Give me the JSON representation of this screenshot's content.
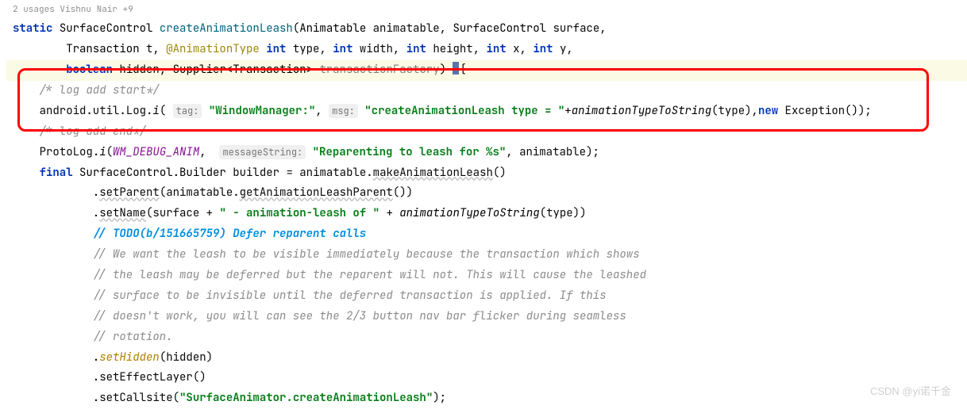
{
  "usage": "2 usages    Vishnu Nair +9",
  "line1": {
    "kw1": "static",
    "type1": "SurfaceControl",
    "method": "createAnimationLeash",
    "p1t": "Animatable",
    "p1n": "animatable",
    "p2t": "SurfaceControl",
    "p2n": "surface"
  },
  "line2": {
    "p3t": "Transaction",
    "p3n": "t",
    "anno": "@AnimationType",
    "kwint": "int",
    "p4n": "type",
    "p5n": "width",
    "p6n": "height",
    "p7n": "x",
    "p8n": "y"
  },
  "line3": {
    "kw": "boolean",
    "p9n": "hidden",
    "p10t": "Supplier<Transaction>",
    "p10n": "transactionFactory",
    "brace": "{"
  },
  "line4": {
    "comment": "/* log add start*/"
  },
  "line5": {
    "prefix": "android.util.Log.",
    "method": "i",
    "hint1": "tag:",
    "str1": "\"WindowManager:\"",
    "hint2": "msg:",
    "str2": "\"createAnimationLeash type = \"",
    "plus": "+",
    "call": "animationTypeToString",
    "arg": "type",
    "kwnew": "new",
    "exc": "Exception"
  },
  "line6": {
    "comment": "/* log add end*/"
  },
  "line7": {
    "cls": "ProtoLog",
    "method": "i",
    "const": "WM_DEBUG_ANIM",
    "hint": "messageString:",
    "str": "\"Reparenting to leash for %s\"",
    "arg": "animatable"
  },
  "line8": {
    "kw": "final",
    "type": "SurfaceControl.Builder",
    "var": "builder",
    "eq": "=",
    "obj": "animatable",
    "method": "makeAnimationLeash"
  },
  "line9": {
    "method": "setParent",
    "obj": "animatable",
    "call": "getAnimationLeashParent"
  },
  "line10": {
    "method": "setName",
    "arg1": "surface",
    "str": "\" - animation-leash of \"",
    "call": "animationTypeToString",
    "arg2": "type"
  },
  "line11": {
    "comment": "// TODO(b/151665759) Defer reparent calls"
  },
  "line12": {
    "comment": "// We want the leash to be visible immediately because the transaction which shows"
  },
  "line13": {
    "comment": "// the leash may be deferred but the reparent will not. This will cause the leashed"
  },
  "line14": {
    "comment": "// surface to be invisible until the deferred transaction is applied. If this"
  },
  "line15": {
    "comment": "// doesn't work, you will can see the 2/3 button nav bar flicker during seamless"
  },
  "line16": {
    "comment": "// rotation."
  },
  "line17": {
    "method": "setHidden",
    "arg": "hidden"
  },
  "line18": {
    "method": "setEffectLayer"
  },
  "line19": {
    "method": "setCallsite",
    "str": "\"SurfaceAnimator.createAnimationLeash\""
  },
  "watermark": "CSDN @yi诺千金"
}
